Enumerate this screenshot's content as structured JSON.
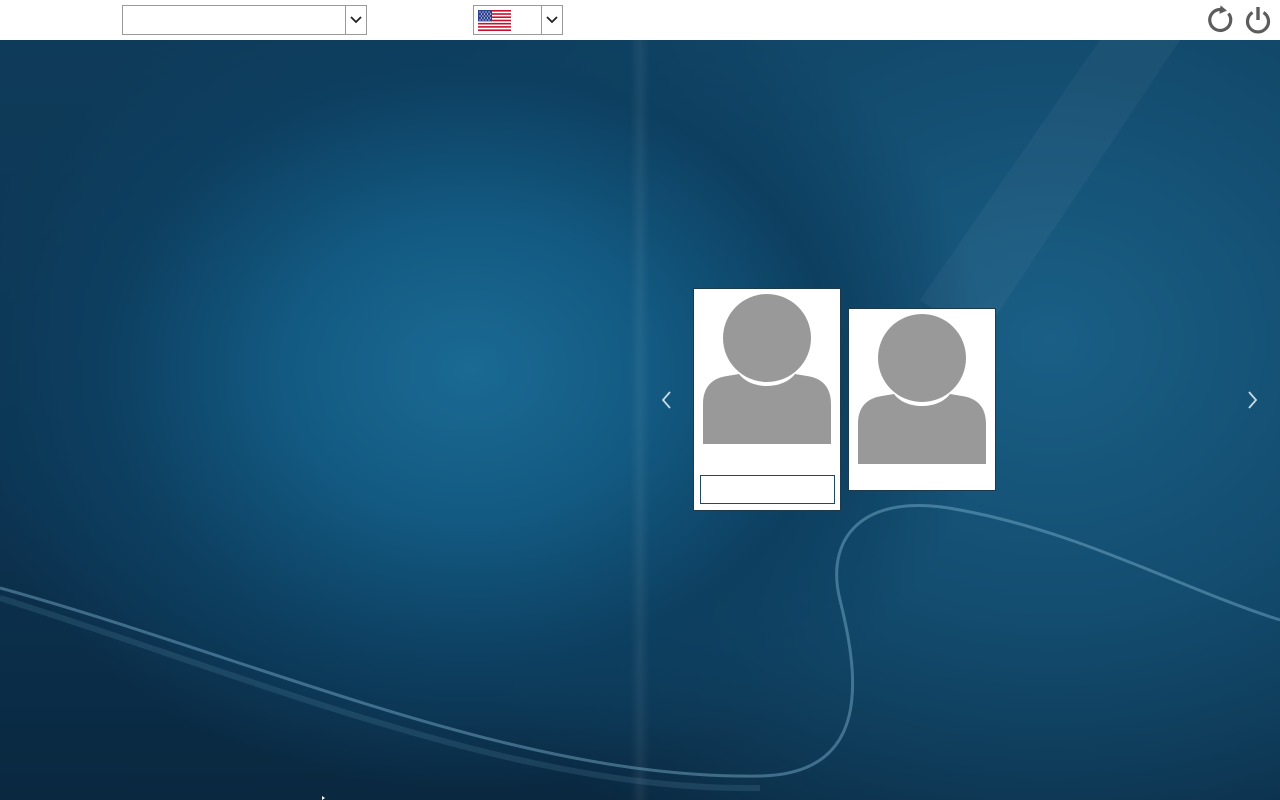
{
  "topbar": {
    "session_select": {
      "selected": "",
      "icon": "chevron-down-icon"
    },
    "language_select": {
      "selected_flag": "us-flag-icon",
      "icon": "chevron-down-icon"
    },
    "reboot_button": {
      "icon": "reboot-icon"
    },
    "power_button": {
      "icon": "power-icon"
    }
  },
  "users": [
    {
      "avatar": "default-user-avatar",
      "password_value": "",
      "selected": true
    },
    {
      "avatar": "default-user-avatar",
      "selected": false
    }
  ],
  "navigation": {
    "previous_icon": "chevron-left-icon",
    "next_icon": "chevron-right-icon"
  },
  "colors": {
    "topbar_background": "#ffffff",
    "wallpaper_base": "#0c3351",
    "wallpaper_highlight": "#1a6a94",
    "avatar_gray": "#999999",
    "control_icon_gray": "#5c5c5c"
  }
}
